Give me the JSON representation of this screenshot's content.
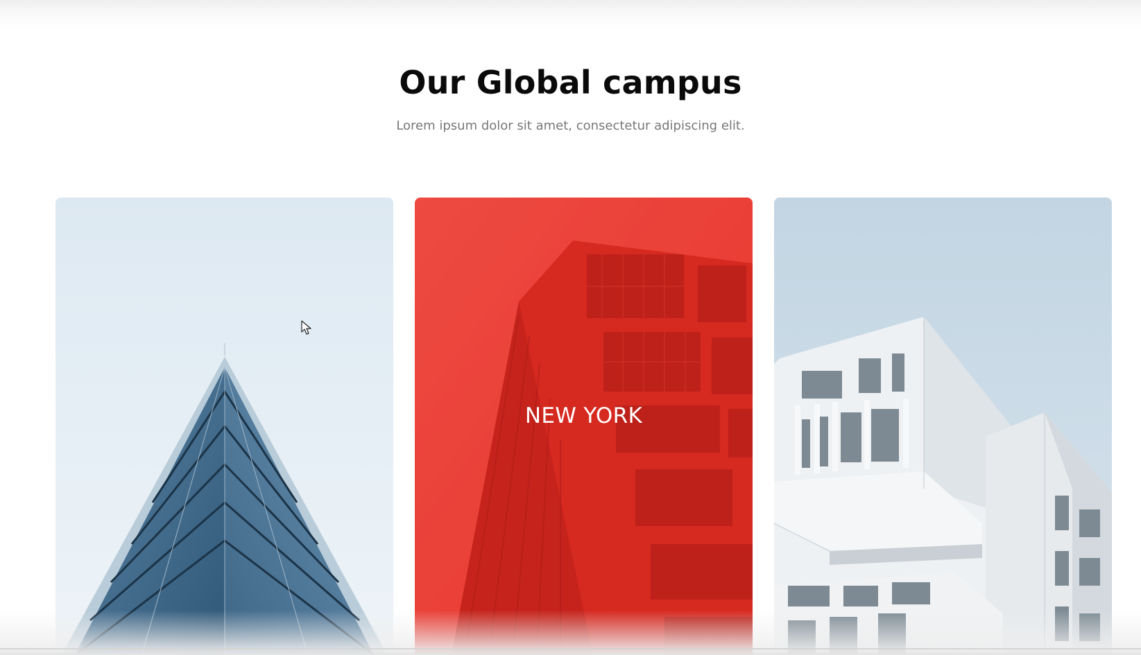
{
  "section": {
    "title": "Our Global campus",
    "subtitle": "Lorem ipsum dolor sit amet, consectetur adipiscing elit."
  },
  "campuses": [
    {
      "image": "glass-pyramid-building",
      "label": ""
    },
    {
      "image": "red-skyscraper",
      "label": "NEW YORK",
      "overlay_color": "#e8332a"
    },
    {
      "image": "white-modular-building",
      "label": ""
    }
  ]
}
